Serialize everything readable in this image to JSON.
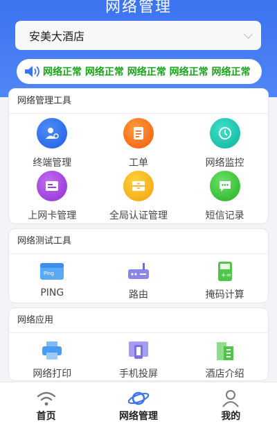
{
  "header": {
    "title": "网络管理"
  },
  "hotel_select": {
    "value": "安美大酒店"
  },
  "marquee": {
    "text": "网络正常 网络正常 网络正常 网络正常 网络正常"
  },
  "sections": {
    "management": {
      "title": "网络管理工具",
      "items": [
        {
          "label": "终端管理"
        },
        {
          "label": "工单"
        },
        {
          "label": "网络监控"
        },
        {
          "label": "上网卡管理"
        },
        {
          "label": "全局认证管理"
        },
        {
          "label": "短信记录"
        }
      ]
    },
    "testing": {
      "title": "网络测试工具",
      "items": [
        {
          "label": "PING",
          "icon_text": "Ping"
        },
        {
          "label": "路由"
        },
        {
          "label": "掩码计算"
        }
      ]
    },
    "apps": {
      "title": "网络应用",
      "items": [
        {
          "label": "网络打印"
        },
        {
          "label": "手机投屏"
        },
        {
          "label": "酒店介绍"
        }
      ]
    }
  },
  "tabbar": {
    "items": [
      {
        "label": "首页"
      },
      {
        "label": "网络管理"
      },
      {
        "label": "我的"
      }
    ]
  },
  "colors": {
    "header": "#3c73f0",
    "status_green": "#1aa31a",
    "active_tab": "#3c73f0"
  }
}
